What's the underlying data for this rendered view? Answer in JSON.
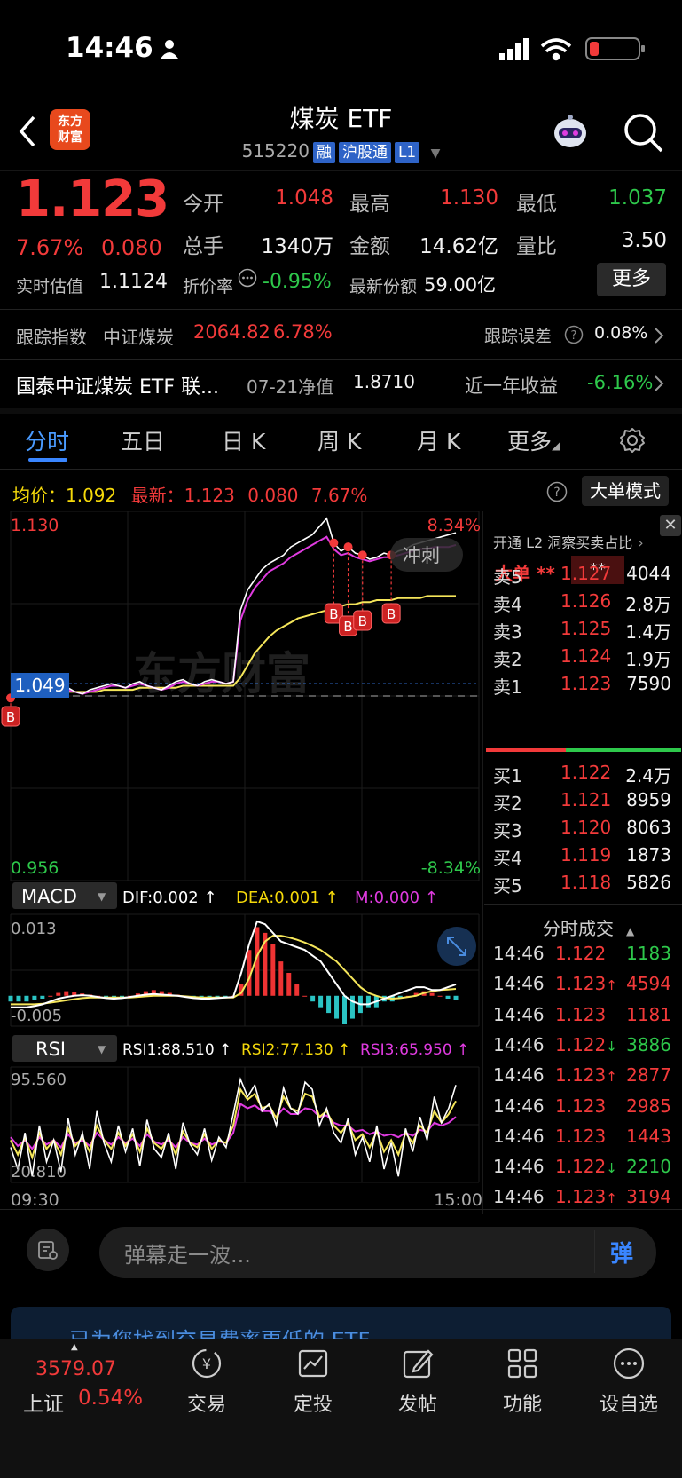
{
  "status": {
    "time": "14:46"
  },
  "header": {
    "logo": "东方\n财富",
    "title": "煤炭 ETF",
    "code": "515220",
    "tags": [
      "融",
      "沪股通",
      "L1"
    ]
  },
  "quote": {
    "price": "1.123",
    "pct": "7.67%",
    "change": "0.080",
    "open_label": "今开",
    "open": "1.048",
    "high_label": "最高",
    "high": "1.130",
    "low_label": "最低",
    "low": "1.037",
    "volume_label": "总手",
    "volume": "1340万",
    "amount_label": "金额",
    "amount": "14.62亿",
    "ratio_label": "量比",
    "ratio": "3.50",
    "est_label": "实时估值",
    "est": "1.1124",
    "premium_label": "折价率",
    "premium": "-0.95%",
    "shares_label": "最新份额",
    "shares": "59.00亿",
    "more_label": "更多"
  },
  "tracking": {
    "label": "跟踪指数",
    "index": "中证煤炭",
    "value": "2064.82",
    "pct": "6.78%",
    "error_label": "跟踪误差",
    "error": "0.08%"
  },
  "fund": {
    "name": "国泰中证煤炭 ETF 联...",
    "date": "07-21净值",
    "nav": "1.8710",
    "return_label": "近一年收益",
    "return": "-6.16%"
  },
  "tabs": [
    "分时",
    "五日",
    "日 K",
    "周 K",
    "月 K",
    "更多"
  ],
  "avg": {
    "avg_label": "均价：",
    "avg": "1.092",
    "latest_label": "最新：",
    "latest": "1.123",
    "chg": "0.080",
    "pct": "7.67%",
    "big_order": "大单模式"
  },
  "chart_data": [
    {
      "type": "line",
      "x_start": "09:30",
      "x_end": "15:00",
      "ylim": [
        0.956,
        1.13
      ],
      "y_top_label": "1.130",
      "y_bottom_label": "0.956",
      "pct_top": "8.34%",
      "pct_bottom": "-8.34%",
      "cursor_label": "1.049",
      "pre_close": 1.043,
      "annotation": "冲刺",
      "watermark": "东方财富",
      "series": [
        {
          "color": "#ffffff",
          "values": [
            1.042,
            1.045,
            1.046,
            1.044,
            1.043,
            1.045,
            1.044,
            1.046,
            1.047,
            1.045,
            1.044,
            1.046,
            1.047,
            1.048,
            1.049,
            1.048,
            1.047,
            1.049,
            1.05,
            1.048,
            1.047,
            1.046,
            1.048,
            1.05,
            1.051,
            1.049,
            1.048,
            1.05,
            1.051,
            1.05,
            1.049,
            1.05,
            1.085,
            1.095,
            1.1,
            1.105,
            1.108,
            1.11,
            1.112,
            1.116,
            1.118,
            1.12,
            1.122,
            1.126,
            1.13,
            1.118,
            1.114,
            1.116,
            1.113,
            1.112,
            1.11,
            1.111,
            1.113,
            1.112,
            1.114,
            1.115,
            1.117,
            1.118,
            1.119,
            1.12,
            1.121,
            1.122,
            1.123
          ]
        },
        {
          "color": "#e03be0",
          "values": [
            1.043,
            1.044,
            1.045,
            1.044,
            1.043,
            1.044,
            1.044,
            1.045,
            1.046,
            1.045,
            1.044,
            1.045,
            1.046,
            1.047,
            1.048,
            1.048,
            1.047,
            1.048,
            1.049,
            1.048,
            1.047,
            1.046,
            1.047,
            1.049,
            1.05,
            1.049,
            1.048,
            1.049,
            1.05,
            1.05,
            1.049,
            1.05,
            1.08,
            1.09,
            1.096,
            1.1,
            1.104,
            1.106,
            1.108,
            1.111,
            1.113,
            1.115,
            1.117,
            1.119,
            1.121,
            1.115,
            1.112,
            1.113,
            1.111,
            1.11,
            1.109,
            1.11,
            1.111,
            1.111,
            1.112,
            1.113,
            1.114,
            1.115,
            1.115,
            1.116,
            1.116,
            1.116,
            1.117
          ]
        },
        {
          "color": "#f5e65a",
          "values": [
            1.043,
            1.044,
            1.044,
            1.044,
            1.044,
            1.044,
            1.044,
            1.045,
            1.045,
            1.045,
            1.045,
            1.045,
            1.045,
            1.046,
            1.046,
            1.046,
            1.046,
            1.046,
            1.047,
            1.047,
            1.047,
            1.047,
            1.047,
            1.047,
            1.048,
            1.048,
            1.048,
            1.048,
            1.048,
            1.048,
            1.048,
            1.048,
            1.052,
            1.058,
            1.064,
            1.068,
            1.072,
            1.075,
            1.077,
            1.079,
            1.081,
            1.082,
            1.083,
            1.084,
            1.085,
            1.086,
            1.087,
            1.088,
            1.088,
            1.089,
            1.089,
            1.09,
            1.09,
            1.09,
            1.091,
            1.091,
            1.091,
            1.091,
            1.092,
            1.092,
            1.092,
            1.092,
            1.092
          ]
        }
      ],
      "markers": [
        {
          "label": "B",
          "index": 0
        },
        {
          "label": "B",
          "index": 45
        },
        {
          "label": "B",
          "index": 47
        },
        {
          "label": "B",
          "index": 49
        },
        {
          "label": "B",
          "index": 53
        }
      ]
    },
    {
      "type": "bar",
      "title": "MACD",
      "legend": [
        "DIF:0.002 ↑",
        "DEA:0.001 ↑",
        "M:0.000 ↑"
      ],
      "ylim": [
        -0.005,
        0.013
      ],
      "y_top_label": "0.013",
      "y_bottom_label": "-0.005",
      "hist": [
        -0.001,
        -0.001,
        -0.001,
        -0.0008,
        -0.0005,
        0,
        0.0005,
        0.0008,
        0.0006,
        0.0004,
        0.0002,
        0,
        -0.0002,
        -0.0004,
        -0.0003,
        0,
        0.0004,
        0.0008,
        0.001,
        0.0008,
        0.0005,
        0.0002,
        0,
        -0.0002,
        -0.0004,
        -0.0004,
        -0.0003,
        -0.0002,
        0,
        0.002,
        0.008,
        0.012,
        0.011,
        0.009,
        0.006,
        0.004,
        0.002,
        0,
        -0.001,
        -0.002,
        -0.003,
        -0.004,
        -0.005,
        -0.004,
        -0.003,
        -0.002,
        -0.002,
        -0.001,
        -0.001,
        -0.0005,
        0,
        0.0005,
        0.0008,
        0.0005,
        0,
        -0.0005,
        -0.0008
      ],
      "dif": [
        -0.002,
        -0.002,
        -0.002,
        -0.0018,
        -0.0015,
        -0.001,
        -0.0005,
        -0.0002,
        0,
        0.0001,
        0,
        -0.0002,
        -0.0004,
        -0.0005,
        -0.0004,
        -0.0002,
        0,
        0.0002,
        0.0003,
        0.0002,
        0.0001,
        0,
        -0.0002,
        -0.0004,
        -0.0005,
        -0.0005,
        -0.0004,
        -0.0003,
        -0.0002,
        0.004,
        0.009,
        0.013,
        0.0125,
        0.011,
        0.0095,
        0.009,
        0.0085,
        0.008,
        0.007,
        0.006,
        0.004,
        0.002,
        0,
        -0.001,
        -0.0015,
        -0.0015,
        -0.001,
        -0.0005,
        0,
        0.0005,
        0.001,
        0.0015,
        0.0015,
        0.001,
        0.001,
        0.0015,
        0.002
      ],
      "dea": [
        -0.0015,
        -0.0015,
        -0.0015,
        -0.0015,
        -0.0014,
        -0.0012,
        -0.001,
        -0.0008,
        -0.0006,
        -0.0004,
        -0.0003,
        -0.0003,
        -0.0003,
        -0.0003,
        -0.0003,
        -0.0003,
        -0.0002,
        -0.0001,
        0,
        0,
        0,
        0,
        -0.0001,
        -0.0002,
        -0.0003,
        -0.0003,
        -0.0003,
        -0.0003,
        -0.0003,
        0.0005,
        0.003,
        0.007,
        0.0095,
        0.0105,
        0.0105,
        0.0102,
        0.0098,
        0.0093,
        0.0087,
        0.008,
        0.007,
        0.006,
        0.0045,
        0.003,
        0.0015,
        0.0005,
        0,
        -0.0004,
        -0.0005,
        -0.0004,
        -0.0002,
        0,
        0.0005,
        0.0008,
        0.001,
        0.0011,
        0.0012
      ]
    },
    {
      "type": "line",
      "title": "RSI",
      "legend": [
        "RSI1:88.510 ↑",
        "RSI2:77.130 ↑",
        "RSI3:65.950 ↑"
      ],
      "ylim": [
        20.81,
        95.56
      ],
      "y_top_label": "95.560",
      "y_bottom_label": "20.810",
      "x_start": "09:30",
      "x_end": "15:00",
      "rsi1": [
        45,
        30,
        55,
        25,
        60,
        35,
        50,
        28,
        65,
        40,
        55,
        30,
        70,
        48,
        35,
        60,
        42,
        58,
        32,
        64,
        44,
        38,
        55,
        30,
        62,
        47,
        40,
        58,
        36,
        52,
        45,
        68,
        92,
        80,
        88,
        70,
        75,
        60,
        86,
        72,
        68,
        90,
        85,
        60,
        72,
        55,
        48,
        65,
        40,
        52,
        35,
        60,
        30,
        48,
        25,
        58,
        42,
        66,
        50,
        80,
        62,
        72,
        88
      ],
      "rsi2": [
        50,
        40,
        52,
        38,
        55,
        44,
        50,
        40,
        58,
        46,
        52,
        42,
        60,
        50,
        44,
        55,
        46,
        54,
        42,
        58,
        48,
        44,
        52,
        40,
        56,
        48,
        45,
        54,
        44,
        50,
        48,
        60,
        85,
        78,
        82,
        72,
        74,
        65,
        80,
        72,
        70,
        82,
        80,
        66,
        70,
        60,
        55,
        62,
        50,
        54,
        45,
        56,
        42,
        50,
        40,
        55,
        48,
        60,
        55,
        70,
        62,
        68,
        77
      ],
      "rsi3": [
        52,
        46,
        50,
        44,
        52,
        47,
        50,
        45,
        54,
        48,
        50,
        46,
        55,
        50,
        47,
        52,
        48,
        51,
        46,
        54,
        49,
        47,
        50,
        45,
        52,
        48,
        47,
        51,
        47,
        49,
        48,
        55,
        75,
        72,
        74,
        70,
        70,
        66,
        72,
        68,
        68,
        72,
        71,
        66,
        67,
        62,
        60,
        60,
        56,
        57,
        54,
        56,
        53,
        54,
        52,
        55,
        53,
        57,
        56,
        62,
        60,
        62,
        66
      ]
    }
  ],
  "order_book": {
    "title": "开通 L2 洞察买卖占比",
    "big_label": "大单",
    "big_val1": "**",
    "big_val2": "**",
    "sell": [
      {
        "label": "卖5",
        "price": "1.127",
        "vol": "4044"
      },
      {
        "label": "卖4",
        "price": "1.126",
        "vol": "2.8万"
      },
      {
        "label": "卖3",
        "price": "1.125",
        "vol": "1.4万"
      },
      {
        "label": "卖2",
        "price": "1.124",
        "vol": "1.9万"
      },
      {
        "label": "卖1",
        "price": "1.123",
        "vol": "7590"
      }
    ],
    "buy": [
      {
        "label": "买1",
        "price": "1.122",
        "vol": "2.4万"
      },
      {
        "label": "买2",
        "price": "1.121",
        "vol": "8959"
      },
      {
        "label": "买3",
        "price": "1.120",
        "vol": "8063"
      },
      {
        "label": "买4",
        "price": "1.119",
        "vol": "1873"
      },
      {
        "label": "买5",
        "price": "1.118",
        "vol": "5826"
      }
    ]
  },
  "ticks": {
    "title": "分时成交",
    "rows": [
      {
        "time": "14:46",
        "price": "1.122",
        "arrow": "",
        "vol": "1183",
        "price_color": "red",
        "vol_color": "green"
      },
      {
        "time": "14:46",
        "price": "1.123",
        "arrow": "↑",
        "vol": "4594",
        "price_color": "red",
        "vol_color": "red"
      },
      {
        "time": "14:46",
        "price": "1.123",
        "arrow": "",
        "vol": "1181",
        "price_color": "red",
        "vol_color": "red"
      },
      {
        "time": "14:46",
        "price": "1.122",
        "arrow": "↓",
        "vol": "3886",
        "price_color": "red",
        "vol_color": "green"
      },
      {
        "time": "14:46",
        "price": "1.123",
        "arrow": "↑",
        "vol": "2877",
        "price_color": "red",
        "vol_color": "red"
      },
      {
        "time": "14:46",
        "price": "1.123",
        "arrow": "",
        "vol": "2985",
        "price_color": "red",
        "vol_color": "red"
      },
      {
        "time": "14:46",
        "price": "1.123",
        "arrow": "",
        "vol": "1443",
        "price_color": "red",
        "vol_color": "red"
      },
      {
        "time": "14:46",
        "price": "1.122",
        "arrow": "↓",
        "vol": "2210",
        "price_color": "red",
        "vol_color": "green"
      },
      {
        "time": "14:46",
        "price": "1.123",
        "arrow": "↑",
        "vol": "3194",
        "price_color": "red",
        "vol_color": "red"
      }
    ]
  },
  "danmaku": {
    "placeholder": "弹幕走一波...",
    "send": "弹"
  },
  "banner": {
    "text": "已为您找到交易费率更低的 ETF"
  },
  "navbar": {
    "index_value": "3579.07",
    "index_name": "上证",
    "index_pct": "0.54%",
    "items": [
      "交易",
      "定投",
      "发帖",
      "功能",
      "设自选"
    ]
  },
  "colors": {
    "red": "#f23a3a",
    "green": "#2ec84b",
    "accent": "#3a86ff",
    "price_line": "#ffffff",
    "avg_line": "#f5e65a",
    "magenta": "#e03be0"
  }
}
